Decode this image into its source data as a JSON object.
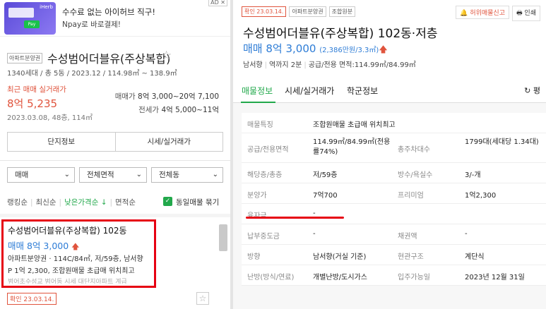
{
  "ad": {
    "thumb_tag": "iHerb",
    "pay_label": "Pay",
    "title": "수수료 없는 아이허브 직구!",
    "subtitle": "Npay로 바로결제!",
    "badge": "AD ✕"
  },
  "complex": {
    "tag": "아파트분양권",
    "name": "수성범어더블유(주상복합)",
    "info": "1340세대 / 총 5동 / 2023.12 / 114.98㎡ ~ 138.9㎡",
    "recent_label": "최근 매매 실거래가",
    "recent_price": "8억 5,235",
    "recent_date": "2023.03.08, 48층, 114㎡",
    "sale_label": "매매가",
    "sale_range": "8억 3,000~20억 7,100",
    "jeonse_label": "전세가",
    "jeonse_range": "4억 5,000~11억"
  },
  "buttons": {
    "info": "단지정보",
    "price": "시세/실거래가"
  },
  "filters": {
    "type": "매매",
    "area": "전체면적",
    "dong": "전체동"
  },
  "sort": {
    "ranking": "랭킹순",
    "latest": "최신순",
    "low_price": "낮은가격순 ↓",
    "area": "면적순",
    "same_group": "동일매물 묶기"
  },
  "listing": {
    "name": "수성범어더블유(주상복합) 102동",
    "price": "매매 8억 3,000",
    "arrow": "🡅",
    "line3": "아파트분양권 · 114C/84㎡, 저/59층, 남서향",
    "line4": "P 1억 2,300, 조합원매물 초급매 위치최고",
    "line5": "범어초수성교 범어동 시세 대단지아파트 계급",
    "confirm": "확인 23.03.14."
  },
  "detail": {
    "chips": [
      "확인 23.03.14.",
      "아파트분양권",
      "조합원분"
    ],
    "report": "🔔 허위매물신고",
    "print": "🖶 인쇄",
    "title": "수성범어더블유(주상복합) 102동·저층",
    "price": "매매 8억 3,000",
    "price_per": "(2,386만원/3.3㎡)",
    "arrow": "🡅",
    "direction": "남서향",
    "distance": "역까지 2분",
    "area": "공급/전용 면적:114.99㎡/84.99㎡",
    "tabs": [
      "매물정보",
      "시세/실거래가",
      "학군정보"
    ],
    "refresh": "↻ 평",
    "rows": [
      {
        "k": "매물특징",
        "v": "조합원매물 초급매 위치최고",
        "k2": "",
        "v2": ""
      },
      {
        "k": "공급/전용면적",
        "v": "114.99㎡/84.99㎡(전용률74%)",
        "k2": "총주차대수",
        "v2": "1799대(세대당 1.34대)"
      },
      {
        "k": "해당층/총층",
        "v": "저/59층",
        "k2": "방수/욕실수",
        "v2": "3/-개"
      },
      {
        "k": "분양가",
        "v": "7억700",
        "k2": "프리미엄",
        "v2": "1억2,300"
      },
      {
        "k": "융자금",
        "v": "-",
        "k2": "",
        "v2": ""
      },
      {
        "k": "납부중도금",
        "v": "-",
        "k2": "채권액",
        "v2": "-"
      },
      {
        "k": "방향",
        "v": "남서향(거실 기준)",
        "k2": "현관구조",
        "v2": "계단식"
      },
      {
        "k": "난방(방식/연료)",
        "v": "개별난방/도시가스",
        "k2": "입주가능일",
        "v2": "2023년 12월 31일"
      }
    ]
  }
}
